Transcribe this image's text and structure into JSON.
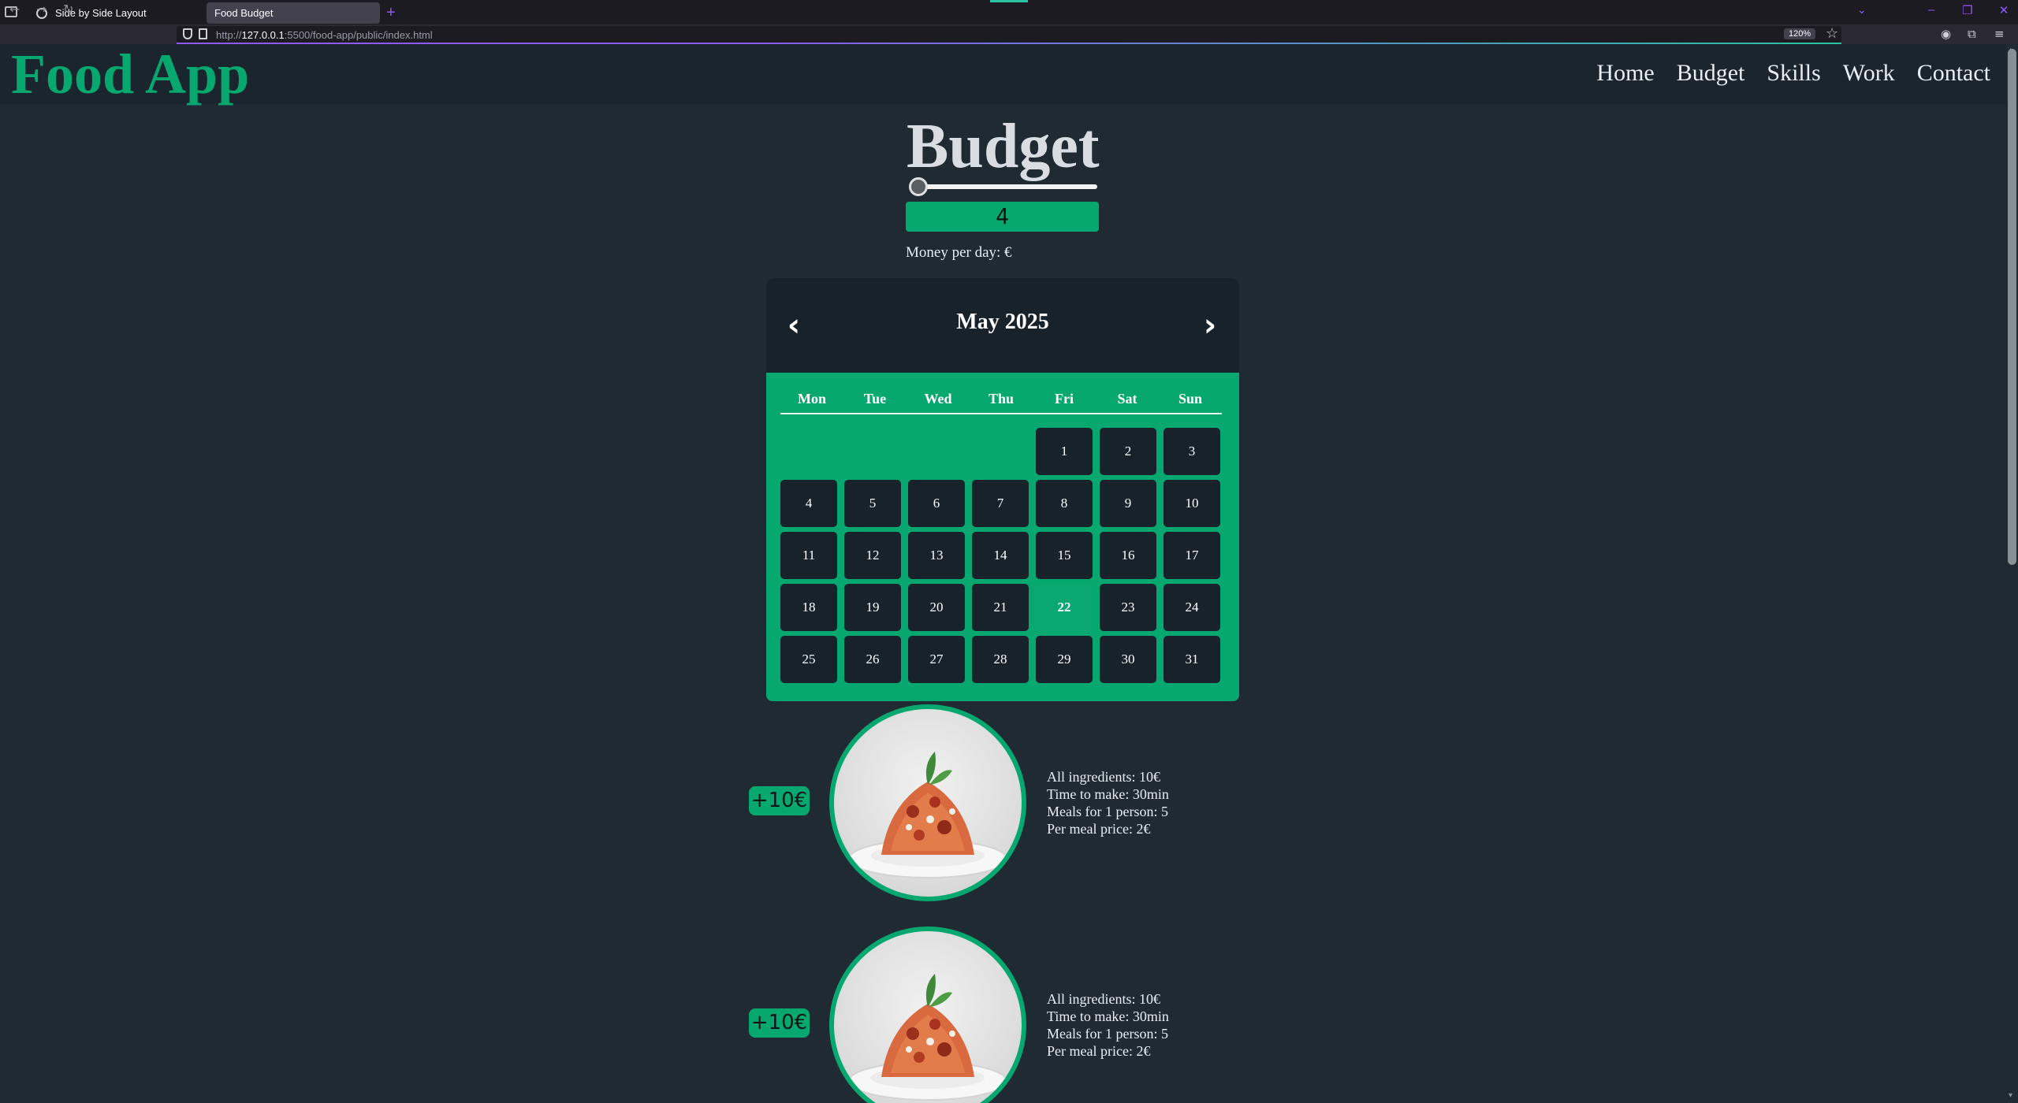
{
  "browser": {
    "tabs": [
      {
        "label": "Side by Side Layout",
        "active": false
      },
      {
        "label": "Food Budget",
        "active": true
      }
    ],
    "url_prefix": "http://",
    "url_host": "127.0.0.1",
    "url_rest": ":5500/food-app/public/index.html",
    "zoom": "120%"
  },
  "site": {
    "logo": "Food App",
    "nav": [
      "Home",
      "Budget",
      "Skills",
      "Work",
      "Contact"
    ],
    "colors": {
      "accent": "#07a86f",
      "background": "#1f2a33",
      "dark": "#18222a"
    }
  },
  "budget": {
    "title": "Budget",
    "slider_value_fraction": 0.0,
    "value": "4",
    "money_label": "Money per day: €"
  },
  "calendar": {
    "title": "May 2025",
    "prev_icon": "chevron-left-icon",
    "next_icon": "chevron-right-icon",
    "weekdays": [
      "Mon",
      "Tue",
      "Wed",
      "Thu",
      "Fri",
      "Sat",
      "Sun"
    ],
    "leading_blanks": 4,
    "days": [
      "1",
      "2",
      "3",
      "4",
      "5",
      "6",
      "7",
      "8",
      "9",
      "10",
      "11",
      "12",
      "13",
      "14",
      "15",
      "16",
      "17",
      "18",
      "19",
      "20",
      "21",
      "22",
      "23",
      "24",
      "25",
      "26",
      "27",
      "28",
      "29",
      "30",
      "31"
    ],
    "today": "22"
  },
  "meals": [
    {
      "badge": "+10€",
      "image": "spaghetti-bolognese",
      "lines": [
        "All ingredients: 10€",
        "Time to make: 30min",
        "Meals for 1 person: 5",
        "Per meal price: 2€"
      ]
    },
    {
      "badge": "+10€",
      "image": "spaghetti-bolognese",
      "lines": [
        "All ingredients: 10€",
        "Time to make: 30min",
        "Meals for 1 person: 5",
        "Per meal price: 2€"
      ]
    }
  ]
}
